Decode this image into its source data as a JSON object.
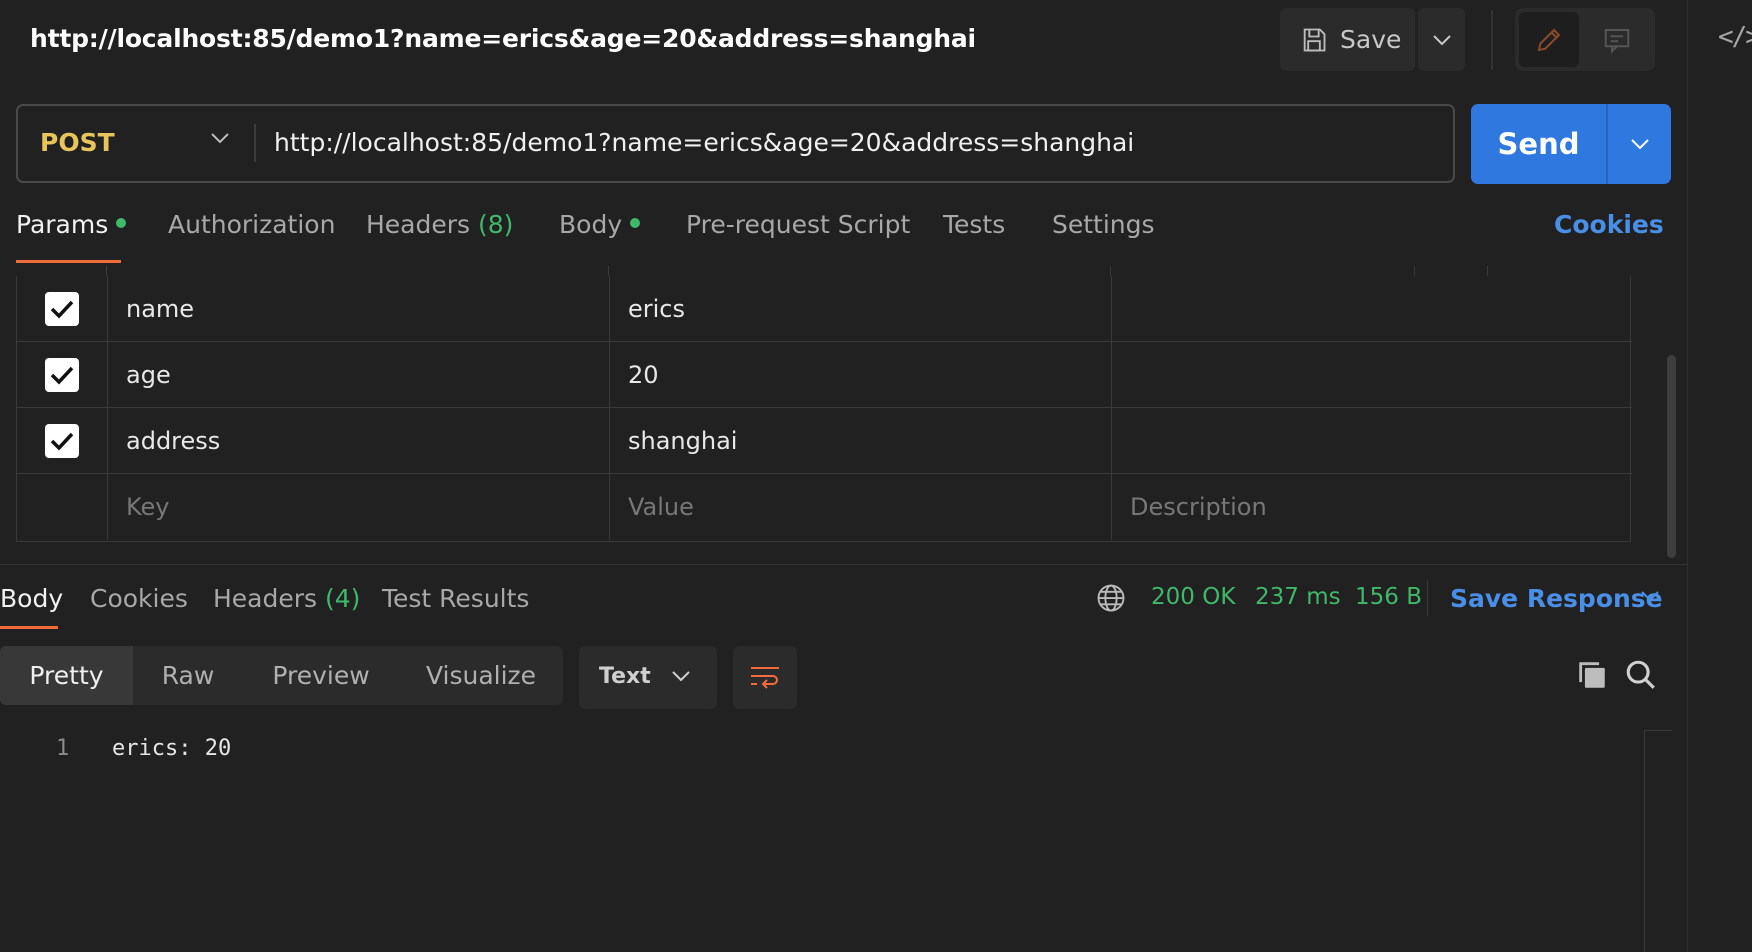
{
  "header": {
    "title": "http://localhost:85/demo1?name=erics&age=20&address=shanghai",
    "save_label": "Save",
    "icons": [
      "save-icon",
      "chevron-down-icon",
      "pencil-icon",
      "comment-icon",
      "code-icon"
    ]
  },
  "request": {
    "method": "POST",
    "url": "http://localhost:85/demo1?name=erics&age=20&address=shanghai",
    "send_label": "Send"
  },
  "tabs": {
    "params": "Params",
    "authorization": "Authorization",
    "headers": "Headers",
    "headers_count": "(8)",
    "body": "Body",
    "prerequest": "Pre-request Script",
    "tests": "Tests",
    "settings": "Settings",
    "cookies": "Cookies"
  },
  "params": {
    "rows": [
      {
        "checked": true,
        "key": "name",
        "value": "erics",
        "description": ""
      },
      {
        "checked": true,
        "key": "age",
        "value": "20",
        "description": ""
      },
      {
        "checked": true,
        "key": "address",
        "value": "shanghai",
        "description": ""
      }
    ],
    "placeholders": {
      "key": "Key",
      "value": "Value",
      "description": "Description"
    }
  },
  "response": {
    "tabs": {
      "body": "Body",
      "cookies": "Cookies",
      "headers": "Headers",
      "headers_count": "(4)",
      "test_results": "Test Results"
    },
    "status": "200 OK",
    "time": "237 ms",
    "size": "156 B",
    "save_response": "Save Response",
    "view_modes": [
      "Pretty",
      "Raw",
      "Preview",
      "Visualize"
    ],
    "format": "Text",
    "lines": [
      {
        "number": "1",
        "text": "erics: 20"
      }
    ]
  },
  "colors": {
    "accent": "#f26b3a",
    "send": "#2e78e0",
    "link": "#4a8fe7",
    "success": "#3fb86a",
    "method_post": "#e8c45a",
    "background": "#212121"
  }
}
